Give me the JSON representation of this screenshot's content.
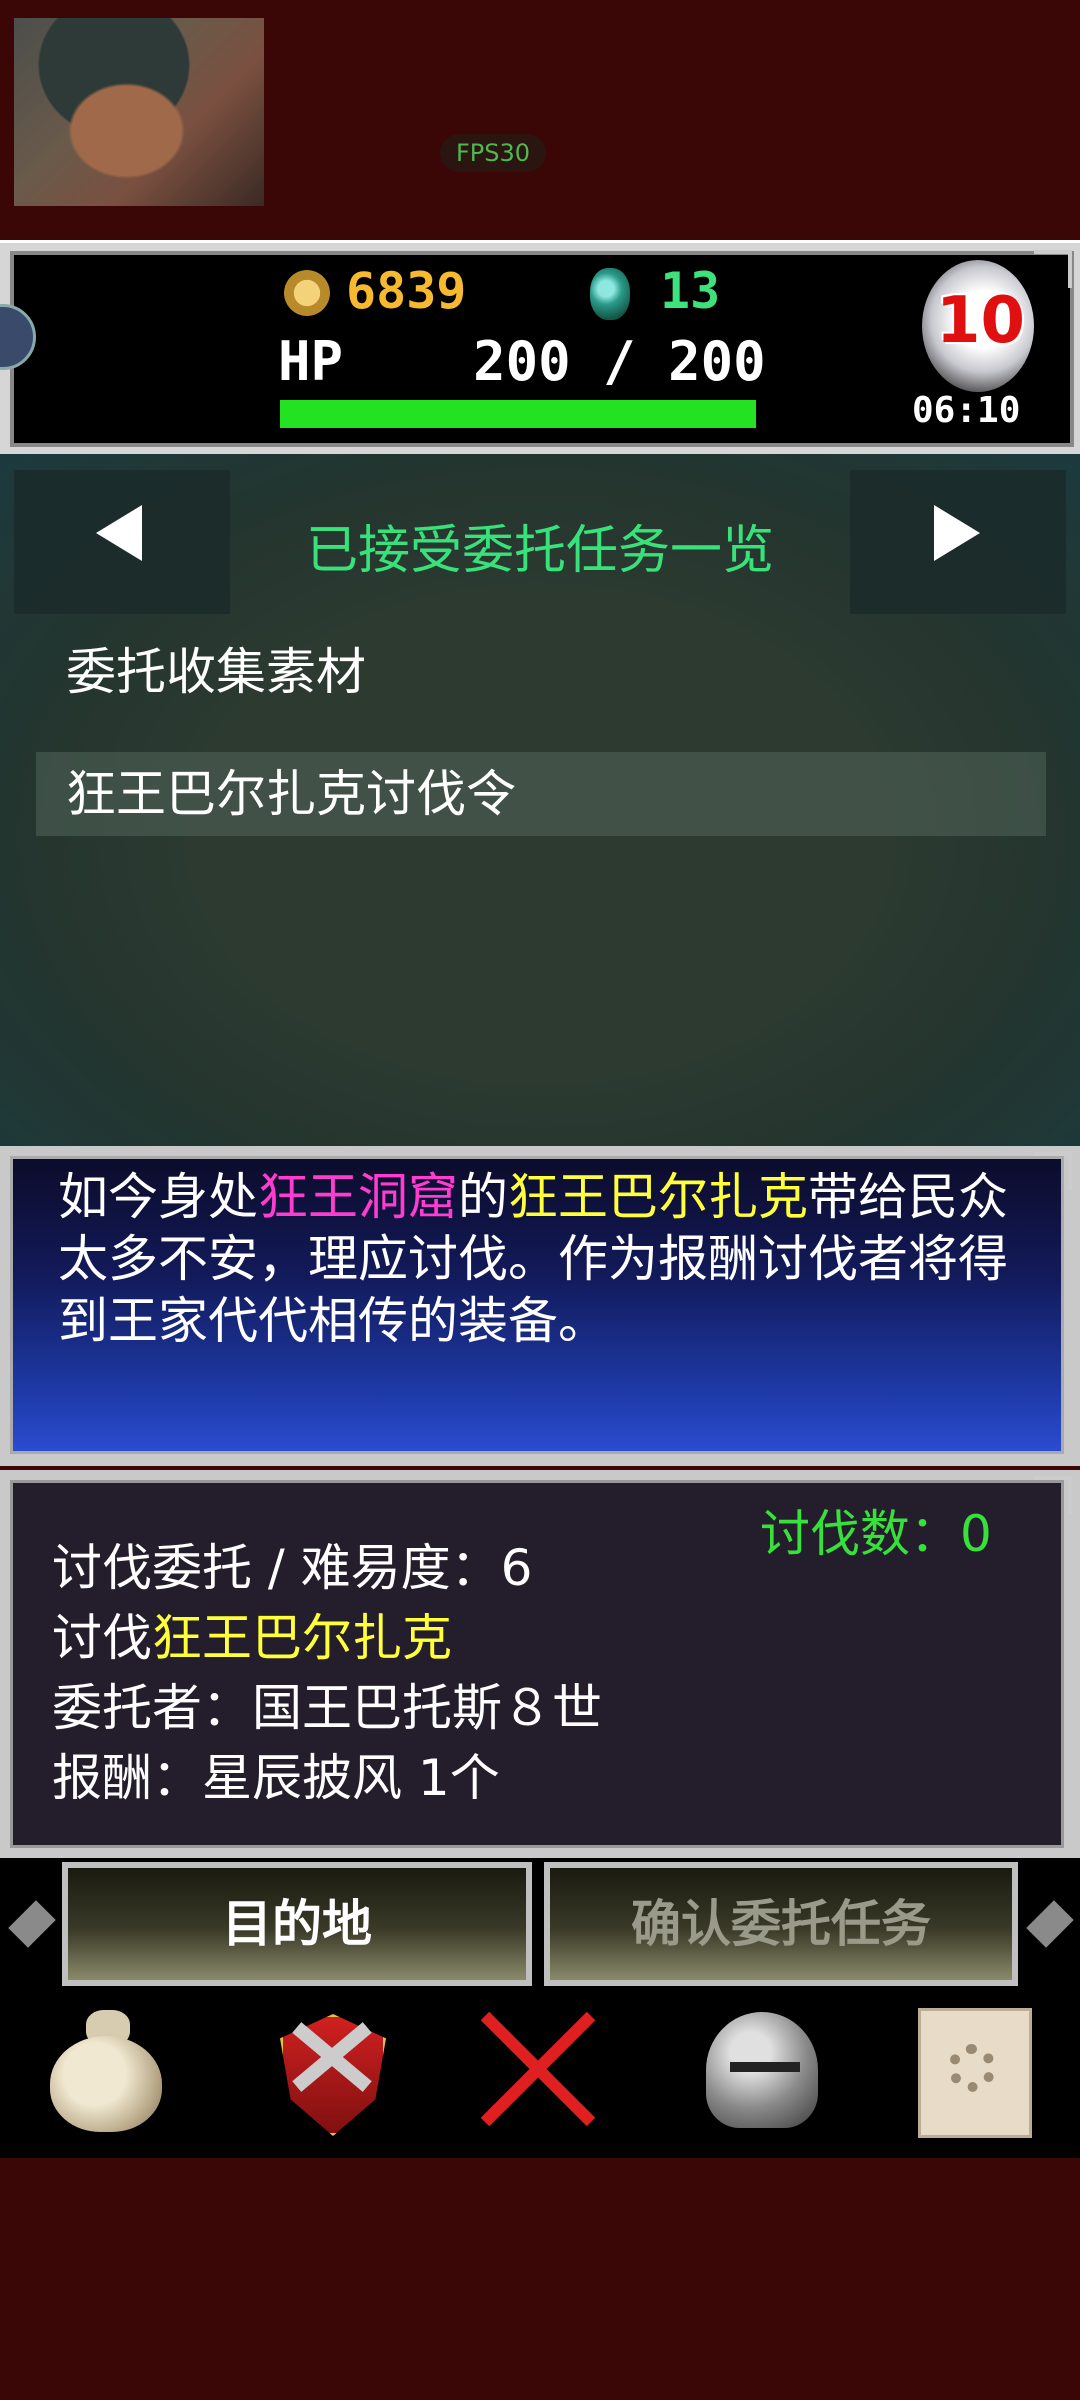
{
  "overlay": {
    "fps": "FPS30"
  },
  "status": {
    "gold": "6839",
    "gems": "13",
    "hp_text": "HP    200 / 200",
    "hp_current": 200,
    "hp_max": 200,
    "day_number": "10",
    "time": "06:10"
  },
  "quest_nav": {
    "title": "已接受委托任务一览",
    "prev_icon": "left-triangle-icon",
    "next_icon": "right-triangle-icon"
  },
  "quest_list": [
    {
      "label": "委托收集素材",
      "selected": false
    },
    {
      "label": "狂王巴尔扎克讨伐令",
      "selected": true
    }
  ],
  "description": {
    "part1": "如今身处",
    "location": "狂王洞窟",
    "part2": "的",
    "boss": "狂王巴尔扎克",
    "part3": "带给民众太多不安，理应讨伐。作为报酬讨伐者将得到王家代代相传的装备。"
  },
  "details": {
    "kill_count": "讨伐数：0",
    "line1": "讨伐委托 / 难易度：6",
    "line2_prefix": "讨伐",
    "line2_target": "狂王巴尔扎克",
    "line3": "委托者：国王巴托斯８世",
    "line4": "报酬：星辰披风 1个"
  },
  "actions": {
    "destination": "目的地",
    "confirm": "确认委托任务"
  },
  "toolbar": [
    {
      "icon": "bag-icon"
    },
    {
      "icon": "shield-swords-icon"
    },
    {
      "icon": "close-icon"
    },
    {
      "icon": "helmet-icon"
    },
    {
      "icon": "map-scroll-icon"
    }
  ],
  "colors": {
    "gold_text": "#f7b92e",
    "gem_text": "#3ee27a",
    "hp_bar": "#22e222",
    "title_text": "#38e27a",
    "location_highlight": "#ff3cd0",
    "name_highlight": "#ffff3a",
    "kill_count_text": "#36e23a",
    "background": "#3a0606"
  }
}
